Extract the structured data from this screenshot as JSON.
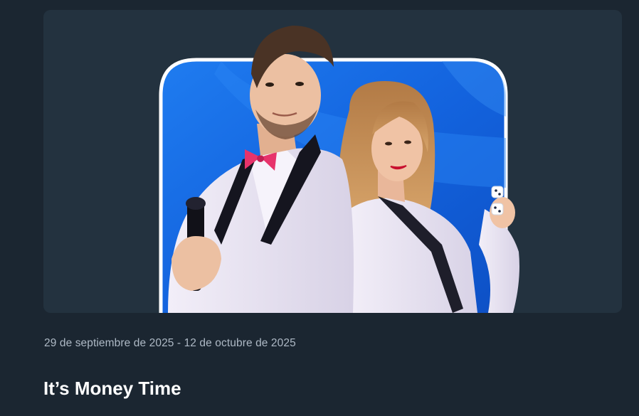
{
  "promotion": {
    "date_range": "29 de septiembre de 2025 - 12 de octubre de 2025",
    "title": "It’s Money Time"
  },
  "colors": {
    "page_background": "#1b2631",
    "card_background": "#23323f",
    "banner_blue": "#1463e0",
    "date_text": "#aeb9c5",
    "title_text": "#ffffff"
  },
  "icons": {
    "dice": "dice-icon",
    "microphone": "microphone-icon"
  }
}
